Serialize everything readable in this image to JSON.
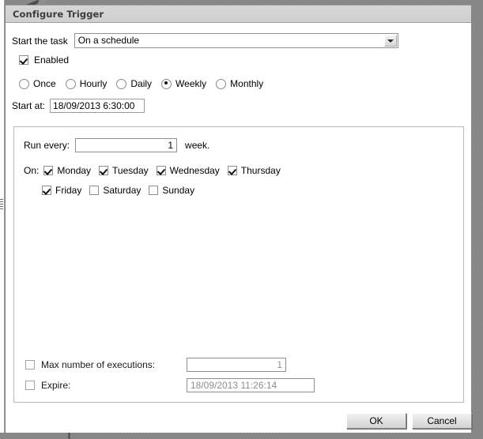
{
  "window": {
    "title": "Configure Trigger"
  },
  "form": {
    "start_task_label": "Start the task",
    "start_task_value": "On a schedule",
    "enabled_label": "Enabled",
    "enabled_checked": true,
    "frequency_options": [
      {
        "label": "Once",
        "selected": false
      },
      {
        "label": "Hourly",
        "selected": false
      },
      {
        "label": "Daily",
        "selected": false
      },
      {
        "label": "Weekly",
        "selected": true
      },
      {
        "label": "Monthly",
        "selected": false
      }
    ],
    "start_at_label": "Start at:",
    "start_at_value": "18/09/2013 6:30:00"
  },
  "weekly": {
    "run_every_label": "Run every:",
    "run_every_value": "1",
    "week_label": "week.",
    "on_label": "On:",
    "days_row1": [
      {
        "label": "Monday",
        "checked": true
      },
      {
        "label": "Tuesday",
        "checked": true
      },
      {
        "label": "Wednesday",
        "checked": true
      },
      {
        "label": "Thursday",
        "checked": true
      }
    ],
    "days_row2": [
      {
        "label": "Friday",
        "checked": true
      },
      {
        "label": "Saturday",
        "checked": false
      },
      {
        "label": "Sunday",
        "checked": false
      }
    ]
  },
  "advanced": {
    "max_exec_label": "Max number of executions:",
    "max_exec_checked": false,
    "max_exec_value": "1",
    "expire_label": "Expire:",
    "expire_checked": false,
    "expire_value": "18/09/2013 11:26:14"
  },
  "footer": {
    "ok_label": "OK",
    "cancel_label": "Cancel"
  },
  "colors": {
    "dialog_background": "#ffffff",
    "titlebar": "#d3d3d3",
    "desktop": "#848484",
    "button_face": "#e2e2e2",
    "disabled_text": "#8e8e8e"
  }
}
